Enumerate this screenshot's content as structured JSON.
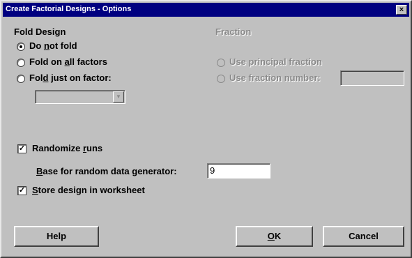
{
  "window": {
    "title": "Create Factorial Designs - Options",
    "close_glyph": "×"
  },
  "fold_design": {
    "title": "Fold Design",
    "options": [
      {
        "pre": "Do ",
        "accel": "n",
        "post": "ot fold",
        "selected": true
      },
      {
        "pre": "Fold on ",
        "accel": "a",
        "post": "ll factors",
        "selected": false
      },
      {
        "pre": "Fol",
        "accel": "d",
        "post": " just on factor:",
        "selected": false
      }
    ],
    "factor_select": {
      "value": "",
      "enabled": false
    }
  },
  "fraction": {
    "title": "Fraction",
    "enabled": false,
    "options": [
      {
        "label": "Use principal fraction",
        "selected": true
      },
      {
        "label": "Use fraction number:",
        "selected": false
      }
    ],
    "number_value": ""
  },
  "randomize": {
    "checked": true,
    "label_pre": "Randomize ",
    "label_accel": "r",
    "label_post": "uns",
    "base": {
      "accel": "B",
      "rest": "ase for random data generator:",
      "value": "9"
    }
  },
  "store": {
    "checked": true,
    "label_accel": "S",
    "label_post": "tore design in worksheet"
  },
  "buttons": {
    "help": "Help",
    "ok_accel": "O",
    "ok_rest": "K",
    "cancel": "Cancel"
  },
  "check_glyph": "✓",
  "combo_arrow_glyph": "▼"
}
